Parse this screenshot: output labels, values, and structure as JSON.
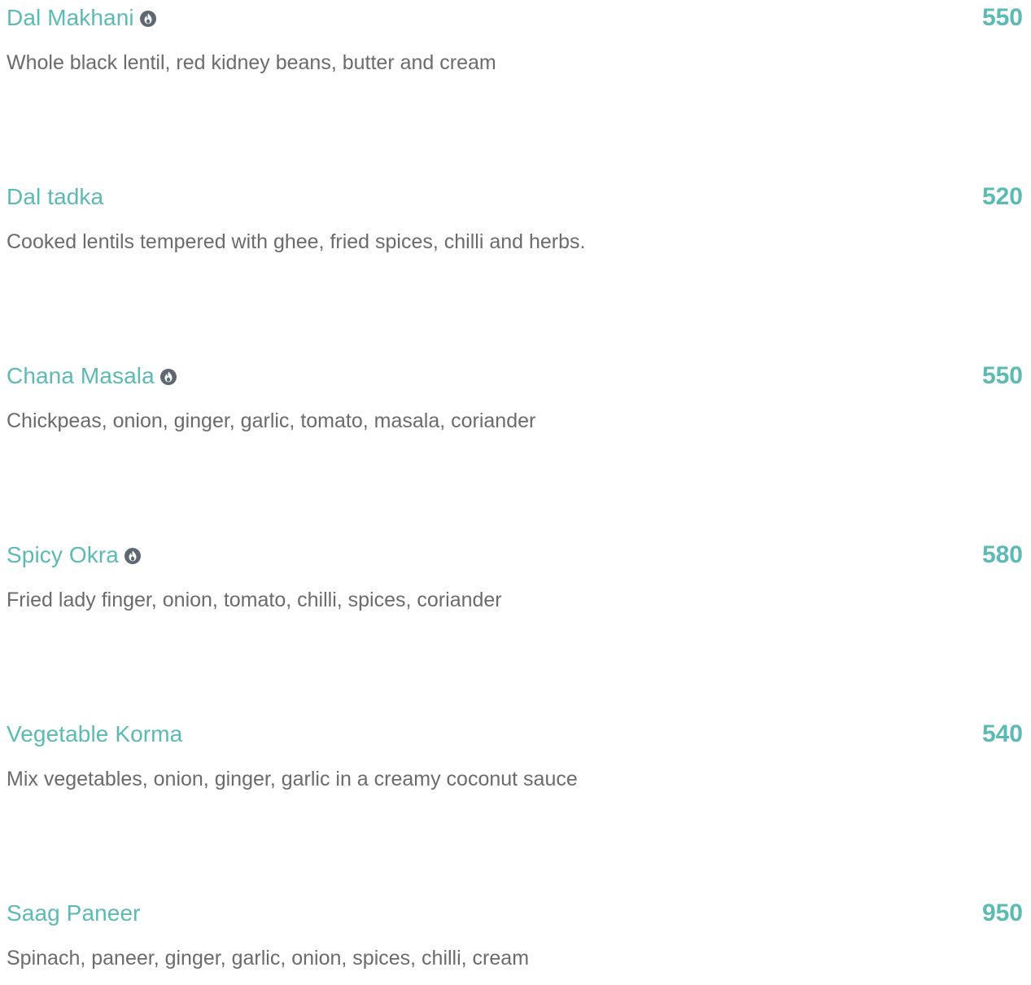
{
  "menu": {
    "items": [
      {
        "name": "Dal Makhani",
        "price": "550",
        "description": "Whole black lentil, red kidney beans, butter and cream",
        "spicy_icon": "chilli-flame-icon"
      },
      {
        "name": "Dal tadka",
        "price": "520",
        "description": "Cooked lentils tempered with ghee, fried spices, chilli and herbs."
      },
      {
        "name": "Chana Masala",
        "price": "550",
        "description": "Chickpeas, onion, ginger, garlic, tomato, masala, coriander",
        "spicy_icon": "chilli-flame-icon"
      },
      {
        "name": "Spicy Okra",
        "price": "580",
        "description": "Fried lady finger, onion, tomato, chilli, spices, coriander",
        "spicy_icon": "chilli-flame-icon"
      },
      {
        "name": "Vegetable Korma",
        "price": "540",
        "description": "Mix vegetables, onion, ginger, garlic in a creamy coconut sauce"
      },
      {
        "name": "Saag Paneer",
        "price": "950",
        "description": "Spinach, paneer, ginger, garlic, onion, spices, chilli, cream"
      }
    ]
  },
  "colors": {
    "accent": "#5cbab5",
    "description_text": "#6c6b6b",
    "icon": "#5f6773"
  }
}
